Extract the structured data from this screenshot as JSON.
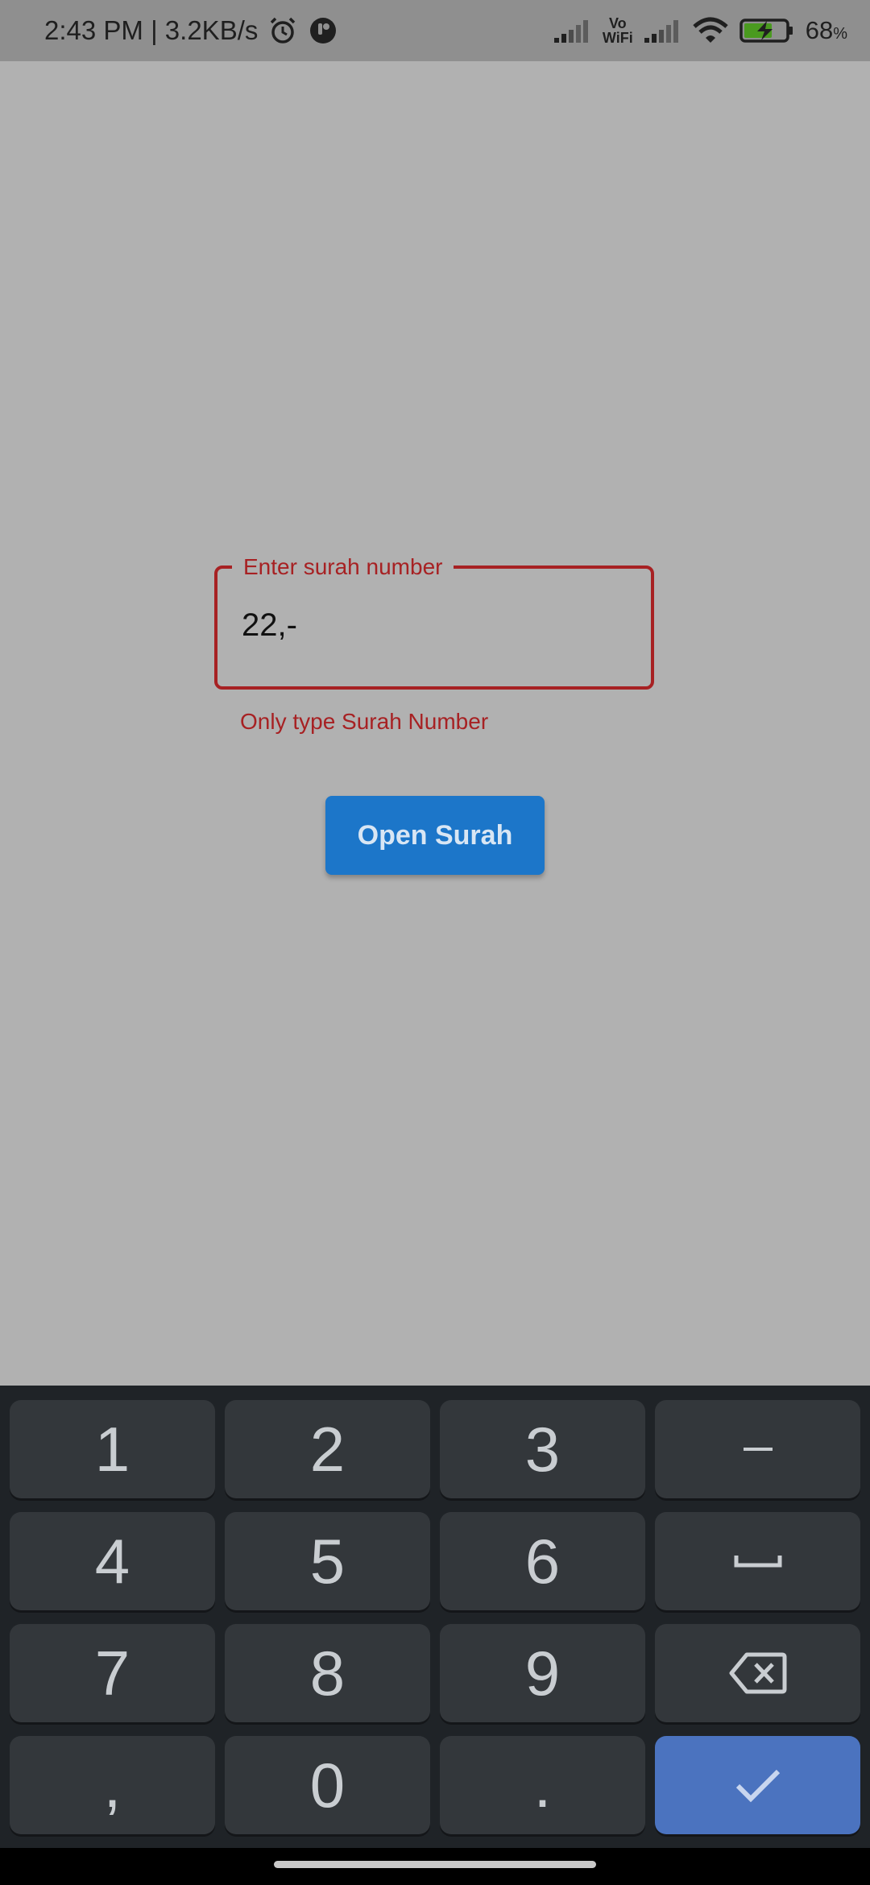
{
  "status_bar": {
    "time_speed": "2:43 PM | 3.2KB/s",
    "vowifi_top": "Vo",
    "vowifi_bottom": "WiFi",
    "battery_percent": "68",
    "percent_sign": "%"
  },
  "form": {
    "label": "Enter surah number",
    "value": "22,-",
    "error": "Only type Surah Number",
    "button_label": "Open Surah"
  },
  "keyboard": {
    "keys": [
      "1",
      "2",
      "3",
      "−",
      "4",
      "5",
      "6",
      "␣",
      "7",
      "8",
      "9",
      "⌫",
      ",",
      "0",
      ".",
      "✓"
    ],
    "accent_color": "#4b73bf"
  },
  "colors": {
    "error": "#a72123",
    "button": "#1c76c9"
  }
}
